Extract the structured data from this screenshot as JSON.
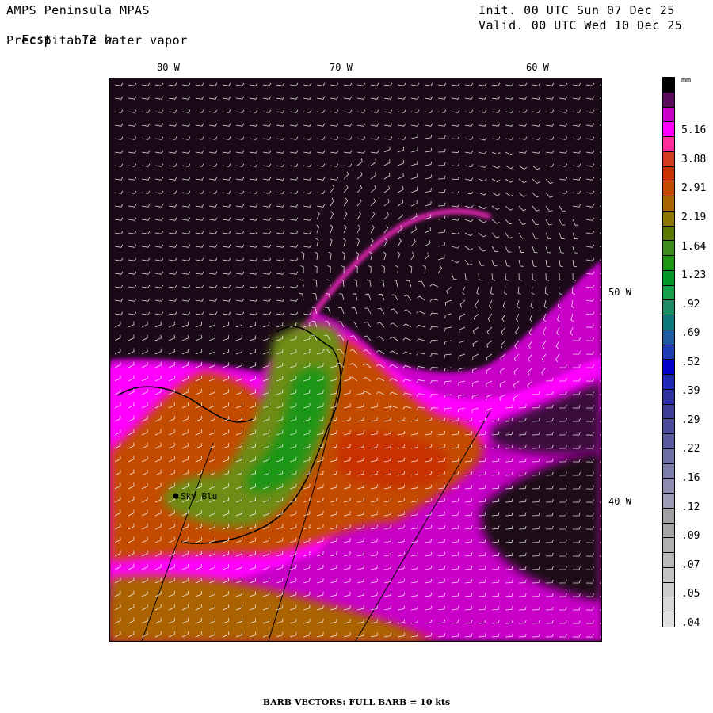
{
  "header": {
    "model": "AMPS Peninsula MPAS",
    "forecast_label": "Fcst.",
    "forecast_hours": "72 h",
    "field": "Precipitable water vapor",
    "init": "Init. 00 UTC Sun 07 Dec 25",
    "valid": "Valid. 00 UTC Wed 10 Dec 25"
  },
  "map": {
    "longitude_labels": [
      "80 W",
      "70 W",
      "60 W"
    ],
    "latitude_labels": [
      "50 W",
      "40 W"
    ],
    "station": {
      "name": "Sky Blu",
      "symbol": "filled-circle"
    },
    "barbs_drawn": true
  },
  "legend": {
    "unit": "mm",
    "labels": [
      "5.16",
      "3.88",
      "2.91",
      "2.19",
      "1.64",
      "1.23",
      ".92",
      ".69",
      ".52",
      ".39",
      ".29",
      ".22",
      ".16",
      ".12",
      ".09",
      ".07",
      ".05",
      ".04"
    ],
    "colors_top_to_bottom": [
      "#000000",
      "#5a0a5a",
      "#c800c8",
      "#ff00ff",
      "#ff2c9c",
      "#d23c1e",
      "#c83200",
      "#c34b00",
      "#aa6400",
      "#8c7800",
      "#5a7800",
      "#3c8c1e",
      "#1e9614",
      "#009628",
      "#14a046",
      "#1e8c64",
      "#0a787d",
      "#1e5aa0",
      "#1e3cb4",
      "#0000c8",
      "#1e28b4",
      "#2d32a0",
      "#3c3c96",
      "#4b4b9b",
      "#5a5aa0",
      "#6e6ea5",
      "#7d7daa",
      "#8c8caf",
      "#9b9bb4",
      "#a0a0a5",
      "#a5a5a5",
      "#afafaf",
      "#b9b9b9",
      "#c3c3c3",
      "#cdcdcd",
      "#d7d7d7",
      "#e1e1e1"
    ]
  },
  "footer": {
    "barb_note": "BARB VECTORS:  FULL BARB = 10 kts"
  }
}
